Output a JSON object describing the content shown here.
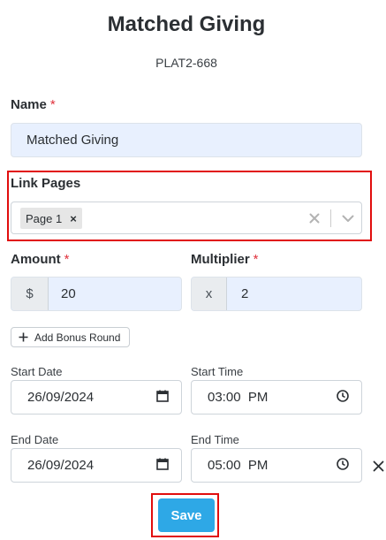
{
  "header": {
    "title": "Matched Giving",
    "code": "PLAT2-668"
  },
  "form": {
    "name": {
      "label": "Name",
      "required_mark": "*",
      "value": "Matched Giving"
    },
    "link_pages": {
      "label": "Link Pages",
      "chips": [
        "Page 1"
      ],
      "chip_remove": "×"
    },
    "amount": {
      "label": "Amount",
      "required_mark": "*",
      "prefix": "$",
      "value": "20"
    },
    "multiplier": {
      "label": "Multiplier",
      "required_mark": "*",
      "prefix": "x",
      "value": "2"
    },
    "add_bonus_label": "Add Bonus Round",
    "add_bonus_icon": "plus-icon",
    "start_date": {
      "label": "Start Date",
      "value": "26/09/2024",
      "icon": "calendar-icon"
    },
    "start_time": {
      "label": "Start Time",
      "value": "03:00  PM",
      "icon": "clock-icon"
    },
    "end_date": {
      "label": "End Date",
      "value": "26/09/2024",
      "icon": "calendar-icon"
    },
    "end_time": {
      "label": "End Time",
      "value": "05:00  PM",
      "icon": "clock-icon"
    },
    "save_label": "Save"
  },
  "colors": {
    "accent": "#2ea8e6",
    "highlight": "#e10d0d",
    "required": "#e0313c",
    "filled_bg": "#e8f0fe"
  }
}
